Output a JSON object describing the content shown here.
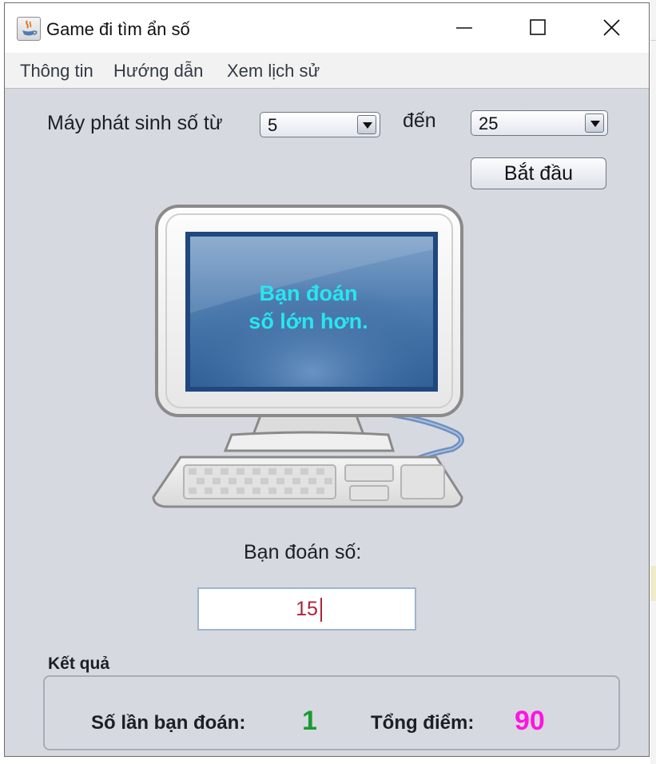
{
  "window": {
    "title": "Game đi tìm ẩn số",
    "controls": [
      "minimize-icon",
      "maximize-icon",
      "close-icon"
    ]
  },
  "menu": {
    "items": [
      {
        "label": "Thông tin"
      },
      {
        "label": "Hướng dẫn"
      },
      {
        "label": "Xem lịch sử"
      }
    ]
  },
  "range": {
    "from_label": "Máy phát sinh số từ",
    "from_value": "5",
    "to_label": "đến",
    "to_value": "25"
  },
  "start_button": {
    "label": "Bắt đầu"
  },
  "screen": {
    "message_line1": "Bạn đoán",
    "message_line2": "số lớn hơn."
  },
  "guess": {
    "label": "Bạn đoán số:",
    "value": "15"
  },
  "result": {
    "title": "Kết quả",
    "attempts_label": "Số lần bạn đoán:",
    "attempts_value": "1",
    "score_label": "Tổng điểm:",
    "score_value": "90"
  },
  "colors": {
    "screen_text": "#27e6ef",
    "attempts_value": "#1a9a36",
    "score_value": "#ff14e0",
    "input_text": "#b0223a",
    "window_bg": "#d6d9e0"
  }
}
